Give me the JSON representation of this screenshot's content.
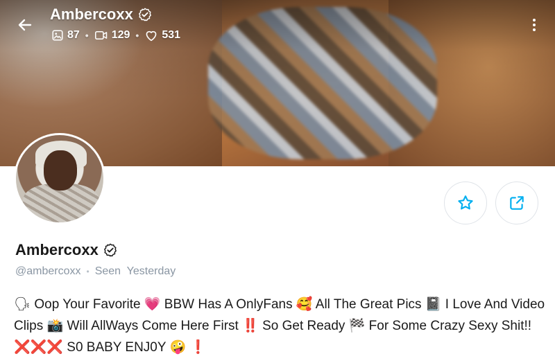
{
  "header": {
    "title": "Ambercoxx",
    "stats": {
      "photos": "87",
      "videos": "129",
      "likes": "531"
    }
  },
  "profile": {
    "name": "Ambercoxx",
    "handle": "@ambercoxx",
    "last_seen": "Seen  Yesterday"
  },
  "bio": {
    "seg1": "Oop Your Favorite",
    "seg2": "BBW Has A OnlyFans",
    "seg3": "All The Great Pics",
    "seg4": "I Love And Video Clips",
    "seg5": "Will AllWays Come Here First",
    "seg6": "So Get Ready",
    "seg7": "For Some Crazy Sexy Shit!!",
    "seg8": "S0 BABY ENJ0Y",
    "emoji": {
      "speaker": "🗣",
      "heart": "💗",
      "smiley_hearts": "🥰",
      "book": "📓",
      "camera": "📸",
      "double_exclaim": "‼️",
      "flag": "🏁",
      "crosses": "❌❌❌",
      "tongue": "🤪",
      "exclaim": "❗"
    }
  },
  "colors": {
    "accent": "#00aff0",
    "muted": "#8a96a3"
  },
  "icons": [
    "back-arrow-icon",
    "verified-icon",
    "image-icon",
    "video-icon",
    "heart-icon",
    "more-vertical-icon",
    "star-icon",
    "share-icon"
  ]
}
